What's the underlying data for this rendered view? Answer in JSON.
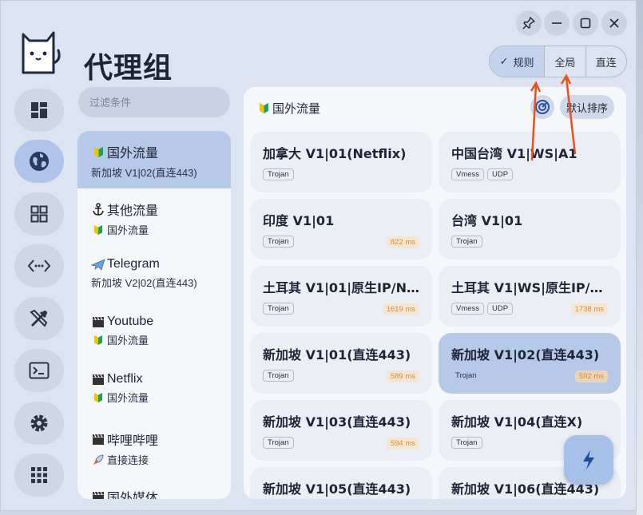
{
  "page": {
    "title": "代理组"
  },
  "modes": [
    {
      "label": "规则",
      "active": true
    },
    {
      "label": "全局",
      "active": false
    },
    {
      "label": "直连",
      "active": false
    }
  ],
  "filter": {
    "placeholder": "过滤条件"
  },
  "groups": [
    {
      "name": "国外流量",
      "sub": "新加坡 V1|02(直连443)",
      "icon": "beginner-icon",
      "sub_icon": ""
    },
    {
      "name": "其他流量",
      "sub": "国外流量",
      "icon": "anchor-icon",
      "sub_icon": "beginner-icon"
    },
    {
      "name": "Telegram",
      "sub": "新加坡 V2|02(直连443)",
      "icon": "airplane-icon",
      "sub_icon": ""
    },
    {
      "name": "Youtube",
      "sub": "国外流量",
      "icon": "clapper-icon",
      "sub_icon": "beginner-icon"
    },
    {
      "name": "Netflix",
      "sub": "国外流量",
      "icon": "clapper-icon",
      "sub_icon": "beginner-icon"
    },
    {
      "name": "哔哩哔哩",
      "sub": "直接连接",
      "icon": "clapper-icon",
      "sub_icon": "rocket-icon"
    },
    {
      "name": "国外媒体",
      "sub": "",
      "icon": "clapper-icon",
      "sub_icon": ""
    }
  ],
  "panel": {
    "title": "国外流量",
    "sort_label": "默认排序"
  },
  "proxies": [
    {
      "name": "加拿大 V1|01(Netflix)",
      "tags": [
        "Trojan"
      ],
      "latency": ""
    },
    {
      "name": "中国台湾 V1|WS|A1",
      "tags": [
        "Vmess",
        "UDP"
      ],
      "latency": ""
    },
    {
      "name": "印度 V1|01",
      "tags": [
        "Trojan"
      ],
      "latency": "822 ms"
    },
    {
      "name": "台湾 V1|01",
      "tags": [
        "Trojan"
      ],
      "latency": ""
    },
    {
      "name": "土耳其 V1|01|原生IP/Net...",
      "tags": [
        "Trojan"
      ],
      "latency": "1619 ms"
    },
    {
      "name": "土耳其 V1|WS|原生IP/Net...",
      "tags": [
        "Vmess",
        "UDP"
      ],
      "latency": "1738 ms"
    },
    {
      "name": "新加坡 V1|01(直连443)",
      "tags": [
        "Trojan"
      ],
      "latency": "589 ms"
    },
    {
      "name": "新加坡 V1|02(直连443)",
      "tags": [
        "Trojan"
      ],
      "latency": "592 ms"
    },
    {
      "name": "新加坡 V1|03(直连443)",
      "tags": [
        "Trojan"
      ],
      "latency": "594 ms"
    },
    {
      "name": "新加坡 V1|04(直连X)",
      "tags": [
        "Trojan"
      ],
      "latency": ""
    },
    {
      "name": "新加坡 V1|05(直连443)",
      "tags": [],
      "latency": ""
    },
    {
      "name": "新加坡 V1|06(直连443)",
      "tags": [],
      "latency": ""
    }
  ],
  "colors": {
    "accent": "#b6c9e9",
    "latency": "#e28b2c",
    "annotation_arrow": "#e8501c"
  }
}
